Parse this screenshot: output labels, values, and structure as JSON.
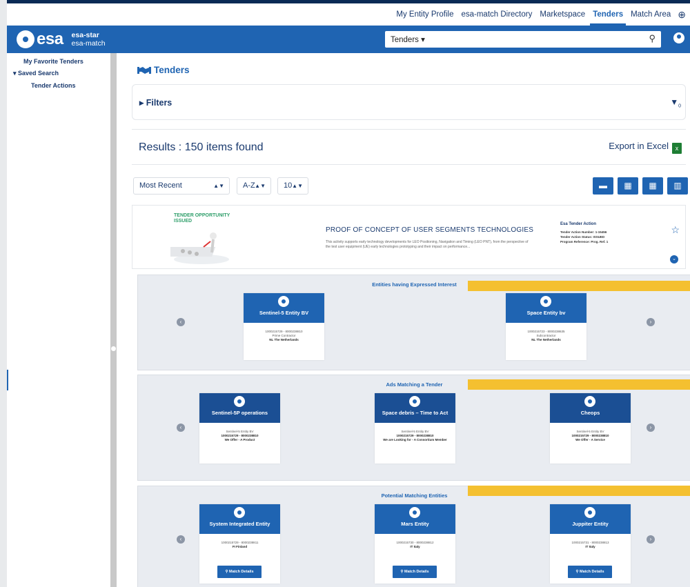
{
  "topnav": {
    "links": [
      "My Entity Profile",
      "esa-match Directory",
      "Marketspace",
      "Tenders",
      "Match Area"
    ],
    "active": "Tenders",
    "globe_icon": "globe-icon"
  },
  "header": {
    "brand": "esa",
    "sub1": "esa-star",
    "sub2": "esa-match",
    "search_scope": "Tenders ▾",
    "search_icon": "search-icon",
    "user_icon": "user-icon",
    "color": "#1f64b2"
  },
  "sidebar": {
    "items": [
      {
        "label": "My Favorite Tenders"
      },
      {
        "label": "▾  Saved Search"
      },
      {
        "label": "Tender Actions"
      }
    ]
  },
  "main": {
    "title": "Tenders",
    "filters_label": "Filters",
    "filter_count": "0",
    "results_label": "Results : 150 items found",
    "export_label": "Export in Excel",
    "sort_by": "Most Recent",
    "sort_order": "A-Z",
    "page_size": "10"
  },
  "tender": {
    "status": "TENDER OPPORTUNITY ISSUED",
    "title": "PROOF OF CONCEPT OF USER SEGMENTS TECHNOLOGIES",
    "description": "This activity supports early technology developments for LEO Positioning, Navigation and Timing (LEO PNT), from the perspective of the test user equipment (UE) early technologies prototyping and their impact on performance...",
    "meta_heading": "Esa Tender Action",
    "meta_lines": [
      "Tender Action Number: 1-15456",
      "Tender Action Status: ISSUED",
      "Program Reference: Prog. Ref. 1"
    ]
  },
  "sections": {
    "interest": {
      "heading": "Entities having Expressed Interest",
      "cards": [
        {
          "name": "Sentinel-5 Entity BV",
          "l1": "1000215729 - 8000238810",
          "l2": "Prime Contractor",
          "l3": "NL The Netherlands"
        },
        {
          "name": "Space Entity bv",
          "l1": "1000215723 - 8000238635",
          "l2": "Subcontractor",
          "l3": "NL The Netherlands"
        }
      ]
    },
    "ads": {
      "heading": "Ads Matching a Tender",
      "cards": [
        {
          "name": "Sentinel-5P operations",
          "l1": "Sentinel-5 Entity BV",
          "l2": "1000215729 - 8000238810",
          "l3": "We Offer - A Product"
        },
        {
          "name": "Space debris – Time to Act",
          "l1": "Sentinel-5 Entity BV",
          "l2": "1000215729 - 8000238810",
          "l3": "We are Looking for - A Consortium Member"
        },
        {
          "name": "Cheops",
          "l1": "Sentinel-5 Entity BV",
          "l2": "1000215729 - 8000238810",
          "l3": "We Offer - A Service"
        }
      ]
    },
    "matching": {
      "heading": "Potential Matching Entities",
      "button_label": "Match Details",
      "cards": [
        {
          "name": "System Integrated Entity",
          "l1": "1000215729 - 8000238811",
          "l3": "FI Finland"
        },
        {
          "name": "Mars Entity",
          "l1": "1000215730 - 8000238812",
          "l3": "IT Italy"
        },
        {
          "name": "Juppiter Entity",
          "l1": "1000215731 - 8000238813",
          "l3": "IT Italy"
        }
      ]
    }
  },
  "highlight_color": "#f4c030"
}
